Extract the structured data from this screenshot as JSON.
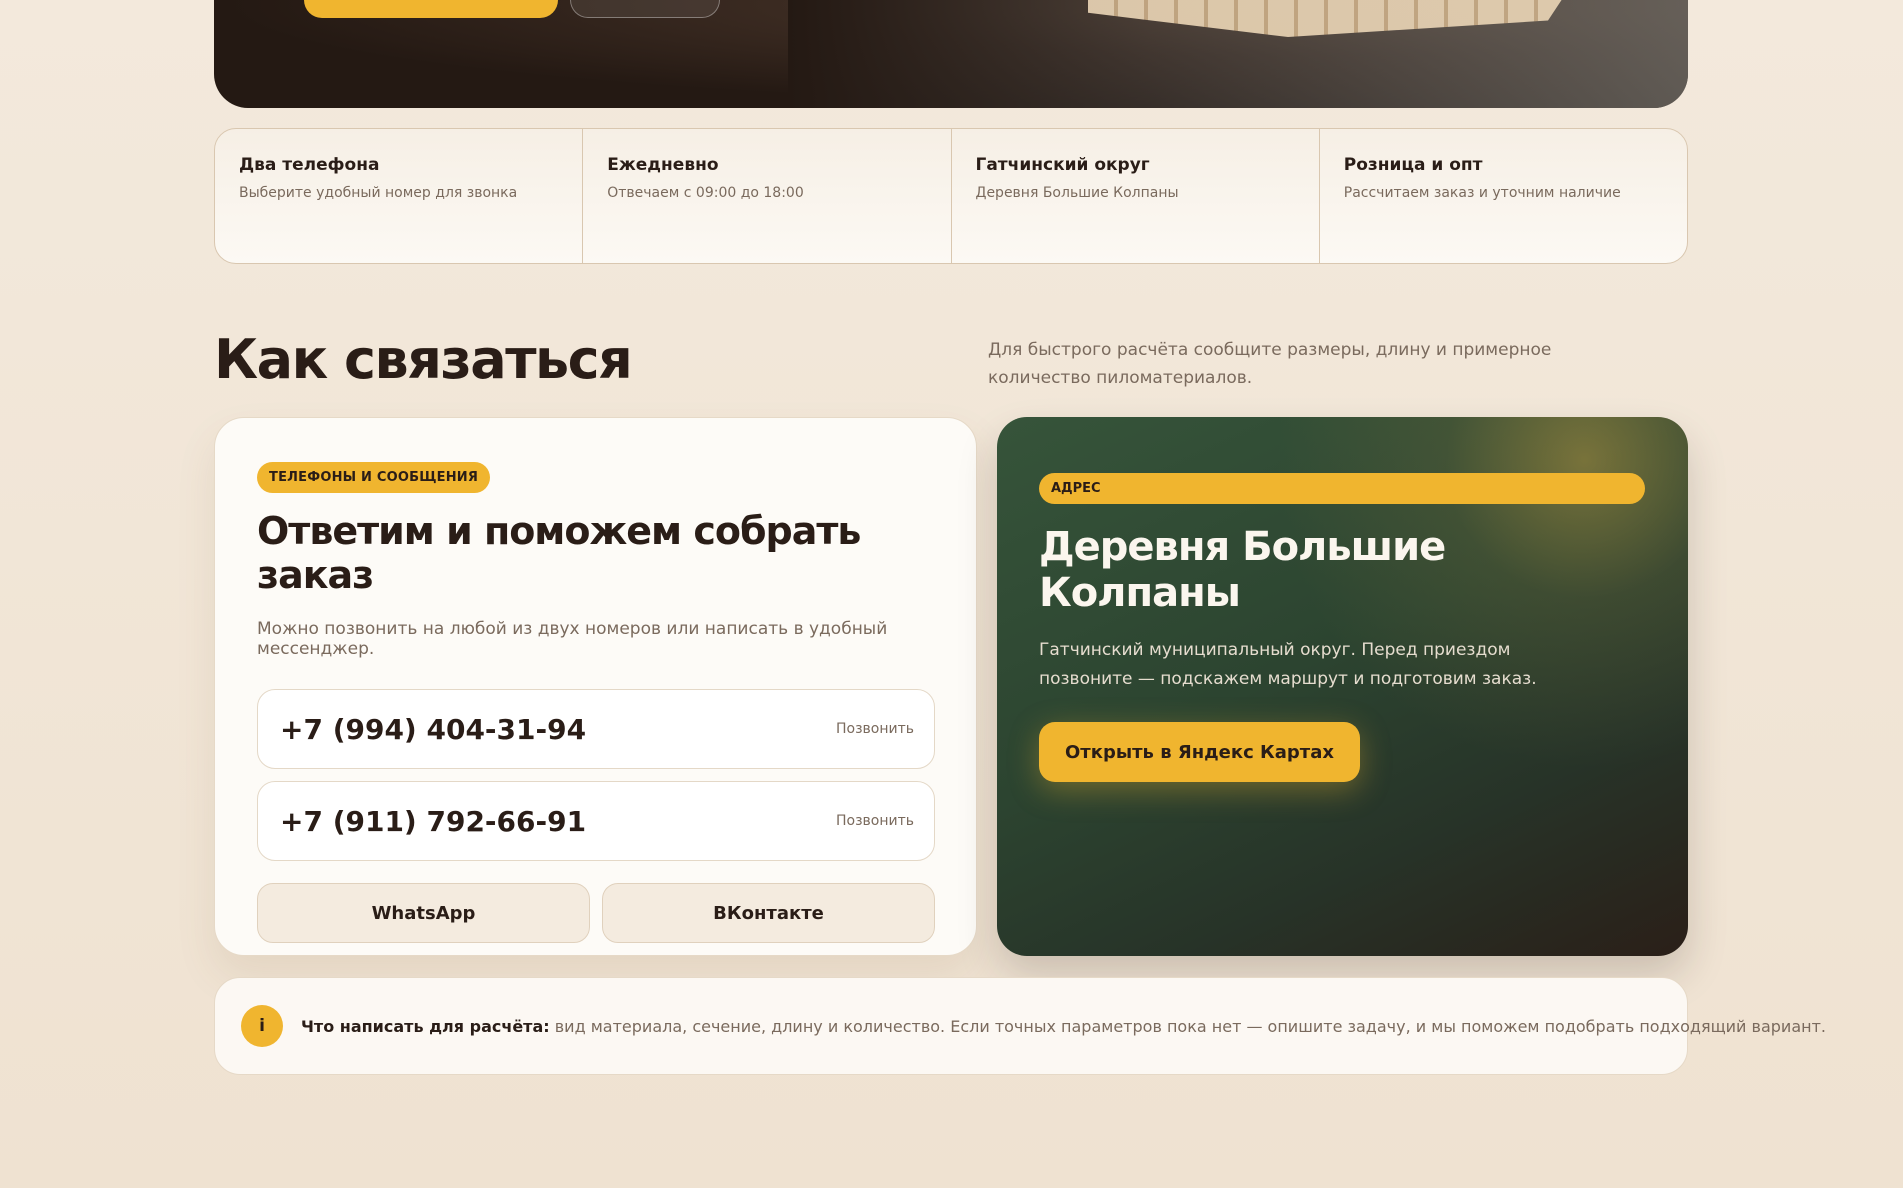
{
  "features": [
    {
      "title": "Два телефона",
      "text": "Выберите удобный номер для звонка"
    },
    {
      "title": "Ежедневно",
      "text": "Отвечаем с 09:00 до 18:00"
    },
    {
      "title": "Гатчинский округ",
      "text": "Деревня Большие Колпаны"
    },
    {
      "title": "Розница и опт",
      "text": "Рассчитаем заказ и уточним наличие"
    }
  ],
  "section": {
    "title": "Как связаться",
    "description": "Для быстрого расчёта сообщите размеры, длину и примерное количество пиломатериалов."
  },
  "contact": {
    "badge": "ТЕЛЕФОНЫ И СООБЩЕНИЯ",
    "title": "Ответим и поможем собрать заказ",
    "lead": "Можно позвонить на любой из двух номеров или написать в удобный мессенджер.",
    "phones": [
      {
        "number": "+7 (994) 404-31-94",
        "action": "Позвонить"
      },
      {
        "number": "+7 (911) 792-66-91",
        "action": "Позвонить"
      }
    ],
    "messengers": [
      "WhatsApp",
      "ВКонтакте"
    ]
  },
  "address": {
    "badge": "АДРЕС",
    "title": "Деревня Большие Колпаны",
    "text": "Гатчинский муниципальный округ. Перед приездом позвоните — подскажем маршрут и подготовим заказ.",
    "map_button": "Открыть в Яндекс Картах"
  },
  "info": {
    "icon_letter": "i",
    "label": "Что написать для расчёта:",
    "text": " вид материала, сечение, длину и количество. Если точных параметров пока нет — опишите задачу, и мы поможем подобрать подходящий вариант."
  },
  "colors": {
    "accent": "#f0b52f",
    "dark_text": "#2a1d17",
    "muted_text": "#7a6a5d",
    "green_card": "#2c4430",
    "page_bg": "#f3e9dc"
  }
}
